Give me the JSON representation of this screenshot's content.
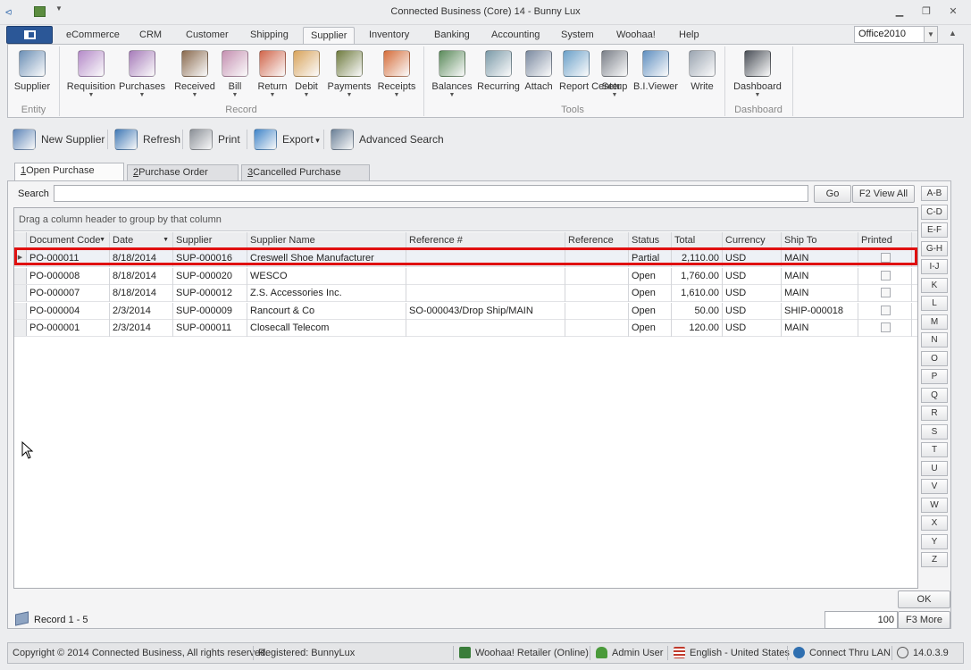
{
  "window": {
    "title": "Connected Business (Core) 14 - Bunny Lux",
    "minimize": "▁",
    "restore": "❐",
    "close": "✕"
  },
  "ribbon_tabs": [
    "eCommerce",
    "CRM",
    "Customer",
    "Shipping",
    "Supplier",
    "Inventory",
    "Banking",
    "Accounting",
    "System",
    "Woohaa!",
    "Help"
  ],
  "active_tab": "Supplier",
  "skin": "Office2010",
  "ribbon": {
    "entity": [
      {
        "label": "Supplier",
        "icon": "supplier-person-icon",
        "color": "#6b8fb5"
      }
    ],
    "record": [
      {
        "label": "Requisition",
        "icon": "requisition-icon",
        "color": "#b48ac8"
      },
      {
        "label": "Purchases",
        "icon": "purchases-icon",
        "color": "#a67bb9"
      },
      {
        "label": "Received",
        "icon": "received-icon",
        "color": "#8a6a4e"
      },
      {
        "label": "Bill",
        "icon": "bill-icon",
        "color": "#c48fb0"
      },
      {
        "label": "Return",
        "icon": "return-icon",
        "color": "#d0654a"
      },
      {
        "label": "Debit",
        "icon": "debit-icon",
        "color": "#d8a35a"
      },
      {
        "label": "Payments",
        "icon": "payments-icon",
        "color": "#6f7b3f"
      },
      {
        "label": "Receipts",
        "icon": "receipts-icon",
        "color": "#d56d3a"
      }
    ],
    "tools": [
      {
        "label": "Balances",
        "icon": "balances-icon",
        "color": "#5a8a5a"
      },
      {
        "label": "Recurring",
        "icon": "recurring-icon",
        "color": "#7b9aa8"
      },
      {
        "label": "Attach",
        "icon": "attach-icon",
        "color": "#7b8aa0"
      },
      {
        "label": "Report Center",
        "icon": "report-center-icon",
        "color": "#6aa0c8"
      },
      {
        "label": "Setup",
        "icon": "setup-gear-icon",
        "color": "#7a7f88"
      },
      {
        "label": "B.I.Viewer",
        "icon": "bi-viewer-icon",
        "color": "#5f8fc0"
      },
      {
        "label": "Write",
        "icon": "write-icon",
        "color": "#9aa4b0"
      }
    ],
    "dashboard": [
      {
        "label": "Dashboard",
        "icon": "dashboard-icon",
        "color": "#4a4f57"
      }
    ],
    "groups": [
      "Entity",
      "Record",
      "Tools",
      "Dashboard"
    ]
  },
  "toolbar": [
    {
      "label": "New Supplier",
      "icon": "new-supplier-icon",
      "color": "#5f86b8"
    },
    {
      "label": "Refresh",
      "icon": "refresh-icon",
      "color": "#3f78b5"
    },
    {
      "label": "Print",
      "icon": "print-icon",
      "color": "#8a8f96"
    },
    {
      "label": "Export",
      "icon": "export-icon",
      "color": "#3f84c8"
    },
    {
      "label": "Advanced Search",
      "icon": "advanced-search-icon",
      "color": "#6a7f96"
    }
  ],
  "page_tabs": [
    {
      "key": "1",
      "label": "Open Purchase Orders"
    },
    {
      "key": "2",
      "label": "Purchase Order History"
    },
    {
      "key": "3",
      "label": "Cancelled Purchase Orders"
    }
  ],
  "search": {
    "label": "Search",
    "value": "",
    "go": "Go",
    "view_all": "F2 View All"
  },
  "grid": {
    "group_hint": "Drag a column header to group by that column",
    "columns": [
      "Document Code",
      "Date",
      "Supplier",
      "Supplier Name",
      "Reference #",
      "Reference",
      "Status",
      "Total",
      "Currency",
      "Ship To",
      "Printed"
    ],
    "rows": [
      [
        "PO-000011",
        "8/18/2014",
        "SUP-000016",
        "Creswell Shoe Manufacturer",
        "",
        "",
        "Partial",
        "2,110.00",
        "USD",
        "MAIN",
        ""
      ],
      [
        "PO-000008",
        "8/18/2014",
        "SUP-000020",
        "WESCO",
        "",
        "",
        "Open",
        "1,760.00",
        "USD",
        "MAIN",
        ""
      ],
      [
        "PO-000007",
        "8/18/2014",
        "SUP-000012",
        "Z.S. Accessories Inc.",
        "",
        "",
        "Open",
        "1,610.00",
        "USD",
        "MAIN",
        ""
      ],
      [
        "PO-000004",
        "2/3/2014",
        "SUP-000009",
        "Rancourt & Co",
        "SO-000043/Drop Ship/MAIN",
        "",
        "Open",
        "50.00",
        "USD",
        "SHIP-000018",
        ""
      ],
      [
        "PO-000001",
        "2/3/2014",
        "SUP-000011",
        "Closecall Telecom",
        "",
        "",
        "Open",
        "120.00",
        "USD",
        "MAIN",
        ""
      ]
    ]
  },
  "alpha_filter": [
    "A-B",
    "C-D",
    "E-F",
    "G-H",
    "I-J",
    "K",
    "L",
    "M",
    "N",
    "O",
    "P",
    "Q",
    "R",
    "S",
    "T",
    "U",
    "V",
    "W",
    "X",
    "Y",
    "Z"
  ],
  "footer": {
    "record": "Record 1 - 5",
    "page_size": "100",
    "ok": "OK",
    "more": "F3 More"
  },
  "status": {
    "copyright": "Copyright © 2014 Connected Business, All rights reserved.",
    "registered": "Registered: BunnyLux",
    "edition": "Woohaa! Retailer (Online)",
    "user": "Admin User",
    "language": "English - United States",
    "connection": "Connect Thru LAN",
    "version": "14.0.3.9"
  }
}
